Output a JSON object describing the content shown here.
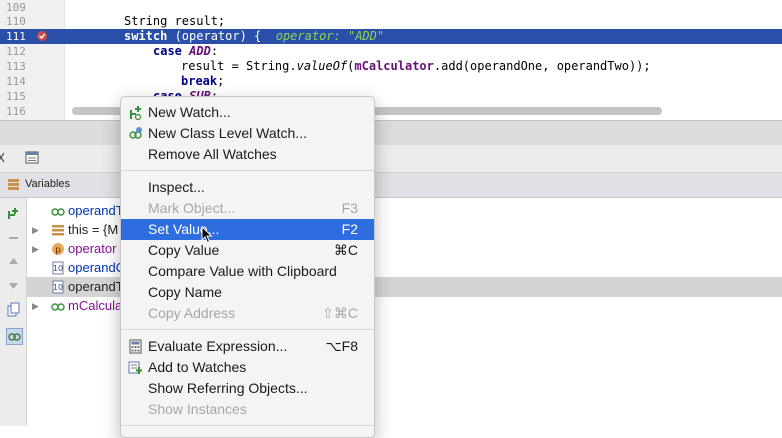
{
  "editor": {
    "lines": [
      {
        "num": "109",
        "code": ""
      },
      {
        "num": "110",
        "code": "String result;"
      },
      {
        "num": "111",
        "kw": "switch",
        "code": " (operator) {  ",
        "inline": "operator: \"ADD\""
      },
      {
        "num": "112",
        "kw": "case",
        "pur": "ADD",
        "code": ":"
      },
      {
        "num": "113",
        "pre": "result = String.",
        "itl": "valueOf",
        "mid": "(",
        "fld": "mCalculator",
        "post": ".add(operandOne, operandTwo));"
      },
      {
        "num": "114",
        "kw": "break",
        "code": ";"
      },
      {
        "num": "115",
        "kw": "case",
        "pur": "SUB",
        "code": ":"
      },
      {
        "num": "116",
        "code": ""
      }
    ]
  },
  "variables_panel": {
    "title": "Variables",
    "rows": [
      {
        "name": "operandT",
        "arrow": ""
      },
      {
        "name": "this = {M",
        "arrow": "▶"
      },
      {
        "name": "operator",
        "arrow": "▶"
      },
      {
        "name": "operandO",
        "arrow": ""
      },
      {
        "name": "operandT",
        "arrow": ""
      },
      {
        "name": "mCalcula",
        "arrow": "▶"
      }
    ]
  },
  "context_menu": {
    "items": [
      {
        "label": "New Watch...",
        "shortcut": "",
        "icon": "add-watch-icon",
        "disabled": false
      },
      {
        "label": "New Class Level Watch...",
        "shortcut": "",
        "icon": "class-watch-icon",
        "disabled": false
      },
      {
        "label": "Remove All Watches",
        "shortcut": "",
        "icon": "",
        "disabled": false
      },
      {
        "label": "Inspect...",
        "shortcut": "",
        "icon": "",
        "disabled": false
      },
      {
        "label": "Mark Object...",
        "shortcut": "F3",
        "icon": "",
        "disabled": true
      },
      {
        "label": "Set Value...",
        "shortcut": "F2",
        "icon": "",
        "disabled": false,
        "active": true
      },
      {
        "label": "Copy Value",
        "shortcut": "⌘C",
        "icon": "",
        "disabled": false
      },
      {
        "label": "Compare Value with Clipboard",
        "shortcut": "",
        "icon": "",
        "disabled": false
      },
      {
        "label": "Copy Name",
        "shortcut": "",
        "icon": "",
        "disabled": false
      },
      {
        "label": "Copy Address",
        "shortcut": "⇧⌘C",
        "icon": "",
        "disabled": true
      },
      {
        "label": "Evaluate Expression...",
        "shortcut": "⌥F8",
        "icon": "calculator-icon",
        "disabled": false
      },
      {
        "label": "Add to Watches",
        "shortcut": "",
        "icon": "watch-add-icon",
        "disabled": false
      },
      {
        "label": "Show Referring Objects...",
        "shortcut": "",
        "icon": "",
        "disabled": false
      },
      {
        "label": "Show Instances",
        "shortcut": "",
        "icon": "",
        "disabled": true
      }
    ]
  },
  "colors": {
    "highlight_line": "#2a4fa8",
    "menu_selection": "#2e6de0",
    "inline_value": "#8fd14f"
  }
}
